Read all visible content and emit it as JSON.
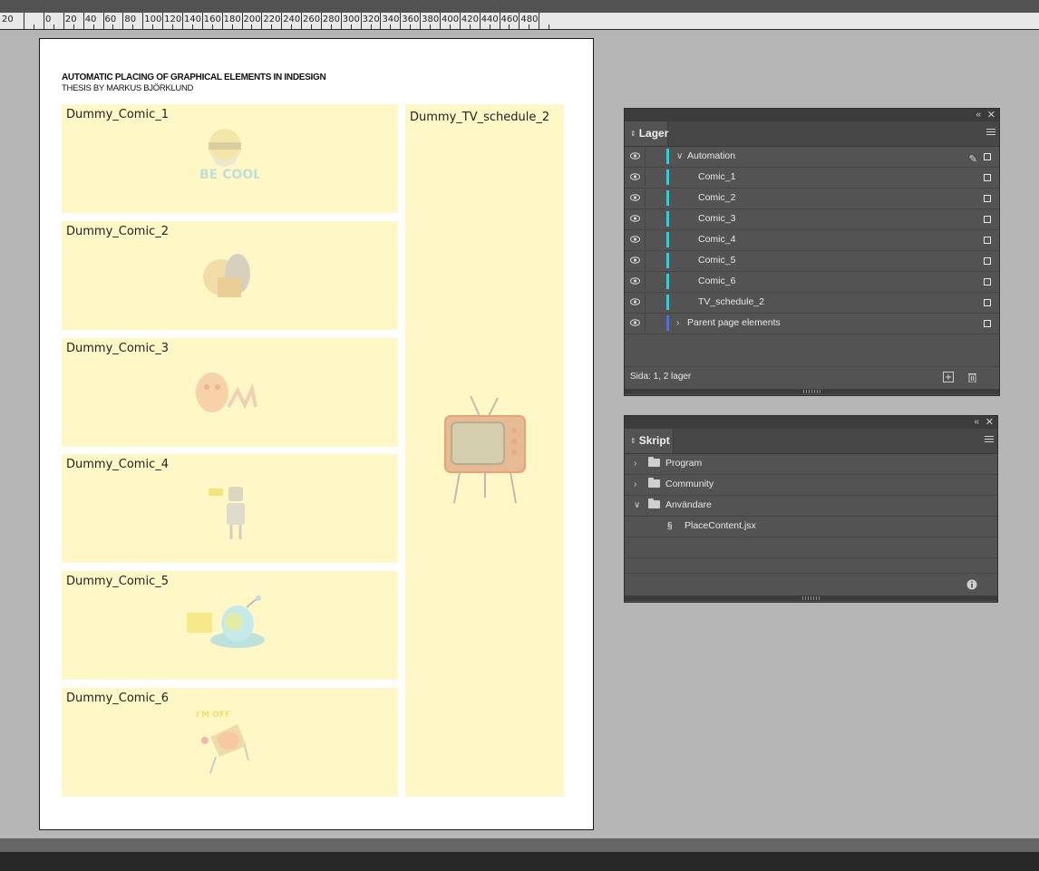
{
  "ruler": {
    "labels": [
      "20",
      "0",
      "20",
      "40",
      "60",
      "80",
      "100",
      "120",
      "140",
      "160",
      "180",
      "200",
      "220",
      "240",
      "260",
      "280",
      "300",
      "320",
      "340",
      "360",
      "380",
      "400",
      "420",
      "440",
      "460",
      "480"
    ]
  },
  "document": {
    "title": "AUTOMATIC PLACING OF GRAPHICAL ELEMENTS IN INDESIGN",
    "subtitle": "THESIS BY MARKUS BJÖRKLUND",
    "frames": [
      {
        "label": "Dummy_Comic_1",
        "art": "be-cool-illustration",
        "art_text": "BE COOL!"
      },
      {
        "label": "Dummy_Comic_2",
        "art": "cats-illustration"
      },
      {
        "label": "Dummy_Comic_3",
        "art": "monster-illustration"
      },
      {
        "label": "Dummy_Comic_4",
        "art": "robot-illustration"
      },
      {
        "label": "Dummy_Comic_5",
        "art": "alien-ufo-illustration"
      },
      {
        "label": "Dummy_Comic_6",
        "art": "beach-chair-illustration",
        "art_text": "I'M OFF"
      }
    ],
    "tv_frame": {
      "label": "Dummy_TV_schedule_2",
      "art": "retro-tv-illustration"
    },
    "frame_fill": "#fff8c6"
  },
  "layers_panel": {
    "tab": "Lager",
    "layers": [
      {
        "name": "Automation",
        "color": "#1ad7e0",
        "expanded": true,
        "level": 0,
        "pen": true
      },
      {
        "name": "Comic_1",
        "color": "#1ad7e0",
        "level": 1
      },
      {
        "name": "Comic_2",
        "color": "#1ad7e0",
        "level": 1
      },
      {
        "name": "Comic_3",
        "color": "#1ad7e0",
        "level": 1
      },
      {
        "name": "Comic_4",
        "color": "#1ad7e0",
        "level": 1
      },
      {
        "name": "Comic_5",
        "color": "#1ad7e0",
        "level": 1
      },
      {
        "name": "Comic_6",
        "color": "#1ad7e0",
        "level": 1
      },
      {
        "name": "TV_schedule_2",
        "color": "#1ad7e0",
        "level": 1
      },
      {
        "name": "Parent page elements",
        "color": "#4f6cf0",
        "expanded": false,
        "level": 0
      }
    ],
    "footer": "Sida: 1, 2 lager"
  },
  "scripts_panel": {
    "tab": "Skript",
    "items": [
      {
        "name": "Program",
        "type": "folder",
        "expanded": false
      },
      {
        "name": "Community",
        "type": "folder",
        "expanded": false
      },
      {
        "name": "Användare",
        "type": "folder",
        "expanded": true
      },
      {
        "name": "PlaceContent.jsx",
        "type": "script"
      }
    ]
  }
}
